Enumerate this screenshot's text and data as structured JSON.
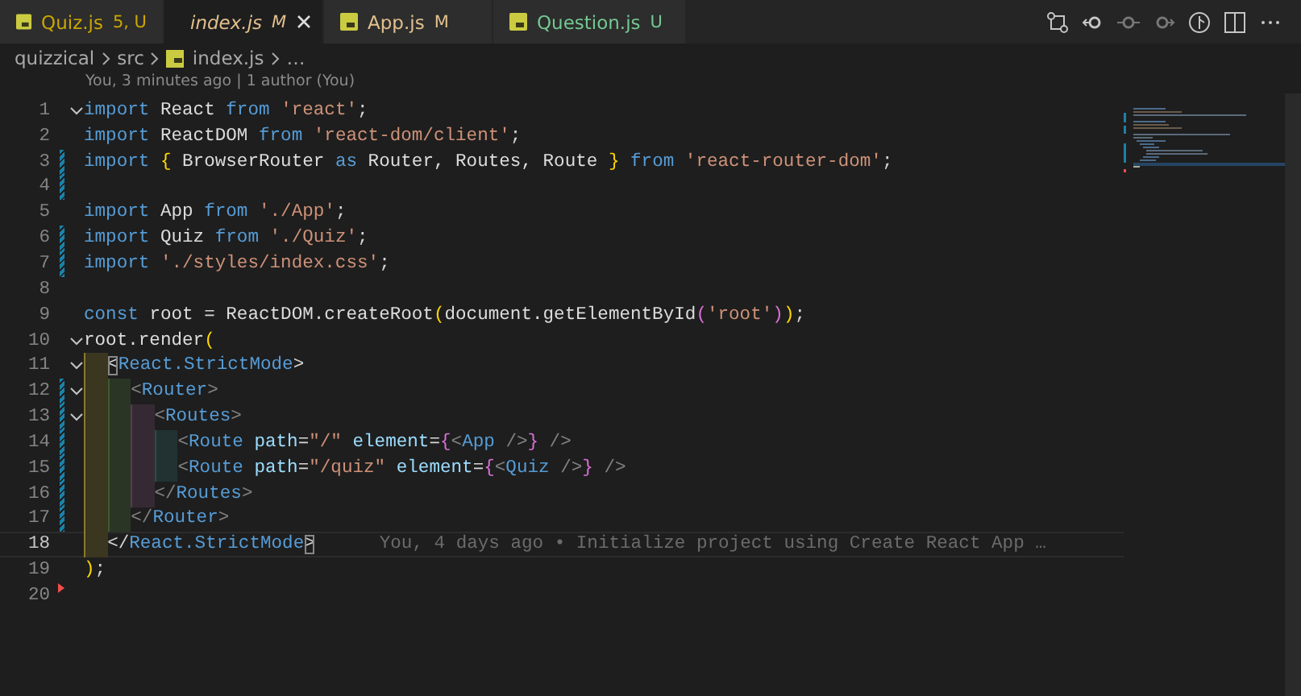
{
  "tabs": [
    {
      "name": "Quiz.js",
      "status": "5, U",
      "color": "#cca700",
      "selected": false,
      "italic": false,
      "closable": false
    },
    {
      "name": "index.js",
      "status": "M",
      "color": "#e2c08d",
      "selected": true,
      "italic": true,
      "closable": true
    },
    {
      "name": "App.js",
      "status": "M",
      "color": "#e2c08d",
      "selected": false,
      "italic": false,
      "closable": false
    },
    {
      "name": "Question.js",
      "status": "U",
      "color": "#73c991",
      "selected": false,
      "italic": false,
      "closable": false
    }
  ],
  "breadcrumb": [
    {
      "label": "quizzical",
      "file": false
    },
    {
      "label": "src",
      "file": false
    },
    {
      "label": "index.js",
      "file": true
    },
    {
      "label": "…",
      "file": false
    }
  ],
  "blame_header": "You, 3 minutes ago | 1 author (You)",
  "lines": [
    {
      "number": "1",
      "fold": true,
      "modified": false,
      "deleted": false,
      "current": false,
      "tokens": [
        {
          "text": "import ",
          "color": "#569cd6"
        },
        {
          "text": "React ",
          "color": "#dcdcdc"
        },
        {
          "text": "from ",
          "color": "#569cd6"
        },
        {
          "text": "'react'",
          "color": "#ce9178"
        },
        {
          "text": ";",
          "color": "#d4d4d4"
        }
      ]
    },
    {
      "number": "2",
      "fold": false,
      "modified": false,
      "deleted": false,
      "current": false,
      "tokens": [
        {
          "text": "import ",
          "color": "#569cd6"
        },
        {
          "text": "ReactDOM ",
          "color": "#dcdcdc"
        },
        {
          "text": "from ",
          "color": "#569cd6"
        },
        {
          "text": "'react-dom/client'",
          "color": "#ce9178"
        },
        {
          "text": ";",
          "color": "#d4d4d4"
        }
      ]
    },
    {
      "number": "3",
      "fold": false,
      "modified": true,
      "deleted": false,
      "current": false,
      "tokens": [
        {
          "text": "import ",
          "color": "#569cd6"
        },
        {
          "text": "{ ",
          "color": "#ffd700"
        },
        {
          "text": "BrowserRouter ",
          "color": "#dcdcdc"
        },
        {
          "text": "as ",
          "color": "#569cd6"
        },
        {
          "text": "Router, Routes, Route ",
          "color": "#dcdcdc"
        },
        {
          "text": "} ",
          "color": "#ffd700"
        },
        {
          "text": "from ",
          "color": "#569cd6"
        },
        {
          "text": "'react-router-dom'",
          "color": "#ce9178"
        },
        {
          "text": ";",
          "color": "#d4d4d4"
        }
      ]
    },
    {
      "number": "4",
      "fold": false,
      "modified": true,
      "deleted": false,
      "current": false
    },
    {
      "number": "5",
      "fold": false,
      "modified": false,
      "deleted": false,
      "current": false,
      "tokens": [
        {
          "text": "import ",
          "color": "#569cd6"
        },
        {
          "text": "App ",
          "color": "#dcdcdc"
        },
        {
          "text": "from ",
          "color": "#569cd6"
        },
        {
          "text": "'./App'",
          "color": "#ce9178"
        },
        {
          "text": ";",
          "color": "#d4d4d4"
        }
      ]
    },
    {
      "number": "6",
      "fold": false,
      "modified": true,
      "deleted": false,
      "current": false,
      "tokens": [
        {
          "text": "import ",
          "color": "#569cd6"
        },
        {
          "text": "Quiz ",
          "color": "#dcdcdc"
        },
        {
          "text": "from ",
          "color": "#569cd6"
        },
        {
          "text": "'./Quiz'",
          "color": "#ce9178"
        },
        {
          "text": ";",
          "color": "#d4d4d4"
        }
      ]
    },
    {
      "number": "7",
      "fold": false,
      "modified": true,
      "deleted": false,
      "current": false,
      "tokens": [
        {
          "text": "import ",
          "color": "#569cd6"
        },
        {
          "text": "'./styles/index.css'",
          "color": "#ce9178"
        },
        {
          "text": ";",
          "color": "#d4d4d4"
        }
      ]
    },
    {
      "number": "8",
      "fold": false,
      "modified": false,
      "deleted": false,
      "current": false
    },
    {
      "number": "9",
      "fold": false,
      "modified": false,
      "deleted": false,
      "current": false,
      "tokens": [
        {
          "text": "const ",
          "color": "#569cd6"
        },
        {
          "text": "root ",
          "color": "#dcdcdc"
        },
        {
          "text": "= ",
          "color": "#d4d4d4"
        },
        {
          "text": "ReactDOM.createRoot",
          "color": "#dcdcdc"
        },
        {
          "text": "(",
          "color": "#ffd700"
        },
        {
          "text": "document.getElementById",
          "color": "#dcdcdc"
        },
        {
          "text": "(",
          "color": "#da70d6"
        },
        {
          "text": "'root'",
          "color": "#ce9178"
        },
        {
          "text": ")",
          "color": "#da70d6"
        },
        {
          "text": ")",
          "color": "#ffd700"
        },
        {
          "text": ";",
          "color": "#d4d4d4"
        }
      ]
    },
    {
      "number": "10",
      "fold": true,
      "modified": false,
      "deleted": false,
      "current": false,
      "tokens": [
        {
          "text": "root.render",
          "color": "#dcdcdc"
        },
        {
          "text": "(",
          "color": "#ffd700"
        }
      ]
    },
    {
      "number": "11",
      "fold": true,
      "modified": false,
      "deleted": false,
      "current": false,
      "tokens": [
        {
          "text": "  <",
          "color": "#d4d4d4",
          "match": true
        },
        {
          "text": "React.StrictMode",
          "color": "#569cd6"
        },
        {
          "text": ">",
          "color": "#d4d4d4"
        }
      ]
    },
    {
      "number": "12",
      "fold": true,
      "modified": true,
      "deleted": false,
      "current": false,
      "tokens": [
        {
          "text": "    <",
          "color": "#808080"
        },
        {
          "text": "Router",
          "color": "#569cd6"
        },
        {
          "text": ">",
          "color": "#808080"
        }
      ]
    },
    {
      "number": "13",
      "fold": true,
      "modified": true,
      "deleted": false,
      "current": false,
      "tokens": [
        {
          "text": "      <",
          "color": "#808080"
        },
        {
          "text": "Routes",
          "color": "#569cd6"
        },
        {
          "text": ">",
          "color": "#808080"
        }
      ]
    },
    {
      "number": "14",
      "fold": false,
      "modified": true,
      "deleted": false,
      "current": false,
      "tokens": [
        {
          "text": "        <",
          "color": "#808080"
        },
        {
          "text": "Route ",
          "color": "#569cd6"
        },
        {
          "text": "path",
          "color": "#9cdcfe"
        },
        {
          "text": "=",
          "color": "#d4d4d4"
        },
        {
          "text": "\"/\" ",
          "color": "#ce9178"
        },
        {
          "text": "element",
          "color": "#9cdcfe"
        },
        {
          "text": "=",
          "color": "#d4d4d4"
        },
        {
          "text": "{",
          "color": "#da70d6"
        },
        {
          "text": "<",
          "color": "#808080"
        },
        {
          "text": "App ",
          "color": "#569cd6"
        },
        {
          "text": "/>",
          "color": "#808080"
        },
        {
          "text": "}",
          "color": "#da70d6"
        },
        {
          "text": " />",
          "color": "#808080"
        }
      ]
    },
    {
      "number": "15",
      "fold": false,
      "modified": true,
      "deleted": false,
      "current": false,
      "tokens": [
        {
          "text": "        <",
          "color": "#808080"
        },
        {
          "text": "Route ",
          "color": "#569cd6"
        },
        {
          "text": "path",
          "color": "#9cdcfe"
        },
        {
          "text": "=",
          "color": "#d4d4d4"
        },
        {
          "text": "\"/quiz\" ",
          "color": "#ce9178"
        },
        {
          "text": "element",
          "color": "#9cdcfe"
        },
        {
          "text": "=",
          "color": "#d4d4d4"
        },
        {
          "text": "{",
          "color": "#da70d6"
        },
        {
          "text": "<",
          "color": "#808080"
        },
        {
          "text": "Quiz ",
          "color": "#569cd6"
        },
        {
          "text": "/>",
          "color": "#808080"
        },
        {
          "text": "}",
          "color": "#da70d6"
        },
        {
          "text": " />",
          "color": "#808080"
        }
      ]
    },
    {
      "number": "16",
      "fold": false,
      "modified": true,
      "deleted": false,
      "current": false,
      "tokens": [
        {
          "text": "      </",
          "color": "#808080"
        },
        {
          "text": "Routes",
          "color": "#569cd6"
        },
        {
          "text": ">",
          "color": "#808080"
        }
      ]
    },
    {
      "number": "17",
      "fold": false,
      "modified": true,
      "deleted": false,
      "current": false,
      "tokens": [
        {
          "text": "    </",
          "color": "#808080"
        },
        {
          "text": "Router",
          "color": "#569cd6"
        },
        {
          "text": ">",
          "color": "#808080"
        }
      ]
    },
    {
      "number": "18",
      "fold": false,
      "modified": false,
      "deleted": false,
      "current": true,
      "blame": "You, 4 days ago • Initialize project using Create React App …",
      "tokens": [
        {
          "text": "  </",
          "color": "#d4d4d4"
        },
        {
          "text": "React.StrictMode",
          "color": "#569cd6"
        },
        {
          "text": ">",
          "color": "#d4d4d4",
          "match": true
        }
      ]
    },
    {
      "number": "19",
      "fold": false,
      "modified": false,
      "deleted": false,
      "current": false,
      "tokens": [
        {
          "text": ")",
          "color": "#ffd700"
        },
        {
          "text": ";",
          "color": "#d4d4d4"
        }
      ]
    },
    {
      "number": "20",
      "fold": false,
      "modified": false,
      "deleted": true,
      "current": false
    }
  ]
}
